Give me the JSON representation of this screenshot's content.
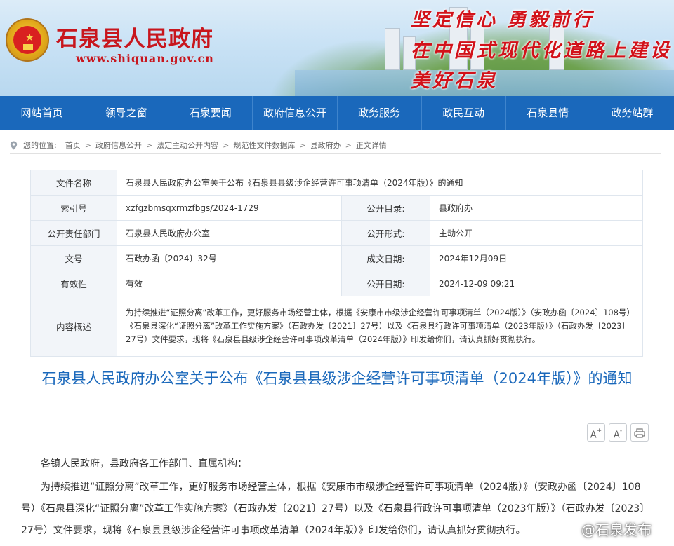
{
  "header": {
    "site_title": "石泉县人民政府",
    "site_url": "www.shiquan.gov.cn",
    "slogans": [
      "坚定信心  勇毅前行",
      "在中国式现代化道路上建设",
      "美好石泉"
    ]
  },
  "nav": {
    "items": [
      "网站首页",
      "领导之窗",
      "石泉要闻",
      "政府信息公开",
      "政务服务",
      "政民互动",
      "石泉县情",
      "政务站群"
    ]
  },
  "breadcrumb": {
    "label": "您的位置:",
    "items": [
      "首页",
      "政府信息公开",
      "法定主动公开内容",
      "规范性文件数据库",
      "县政府办",
      "正文详情"
    ],
    "sep": ">"
  },
  "meta": {
    "file_name_label": "文件名称",
    "file_name": "石泉县人民政府办公室关于公布《石泉县县级涉企经营许可事项清单（2024年版）》的通知",
    "index_label": "索引号",
    "index": "xzfgzbmsqxrmzfbgs/2024-1729",
    "catalog_label": "公开目录:",
    "catalog": "县政府办",
    "dept_label": "公开责任部门",
    "dept": "石泉县人民政府办公室",
    "form_label": "公开形式:",
    "form": "主动公开",
    "doc_no_label": "文号",
    "doc_no": "石政办函〔2024〕32号",
    "date_label": "成文日期:",
    "date": "2024年12月09日",
    "valid_label": "有效性",
    "valid": "有效",
    "pub_label": "公开日期:",
    "pub": "2024-12-09 09:21",
    "summary_label": "内容概述",
    "summary": "为持续推进“证照分离”改革工作，更好服务市场经营主体，根据《安康市市级涉企经营许可事项清单（2024版）》（安政办函〔2024〕108号）《石泉县深化“证照分离”改革工作实施方案》（石政办发〔2021〕27号）以及《石泉县行政许可事项清单（2023年版）》（石政办发〔2023〕27号）文件要求，现将《石泉县县级涉企经营许可事项改革清单（2024年版）》印发给你们，请认真抓好贯彻执行。"
  },
  "document": {
    "title": "石泉县人民政府办公室关于公布《石泉县县级涉企经营许可事项清单（2024年版）》的通知",
    "salutation": "各镇人民政府，县政府各工作部门、直属机构：",
    "paragraph1": "为持续推进“证照分离”改革工作，更好服务市场经营主体，根据《安康市市级涉企经营许可事项清单（2024版）》（安政办函〔2024〕108号）《石泉县深化“证照分离”改革工作实施方案》（石政办发〔2021〕27号）以及《石泉县行政许可事项清单（2023年版）》（石政办发〔2023〕27号）文件要求，现将《石泉县县级涉企经营许可事项改革清单（2024年版）》印发给你们，请认真抓好贯彻执行。"
  },
  "tools": {
    "increase": "A",
    "decrease": "A",
    "inc_sup": "+",
    "dec_sup": "-"
  },
  "watermark": "@石泉发布",
  "colors": {
    "brand_red": "#c8161d",
    "nav_blue": "#1a68bb",
    "title_blue": "#1a68bb"
  }
}
